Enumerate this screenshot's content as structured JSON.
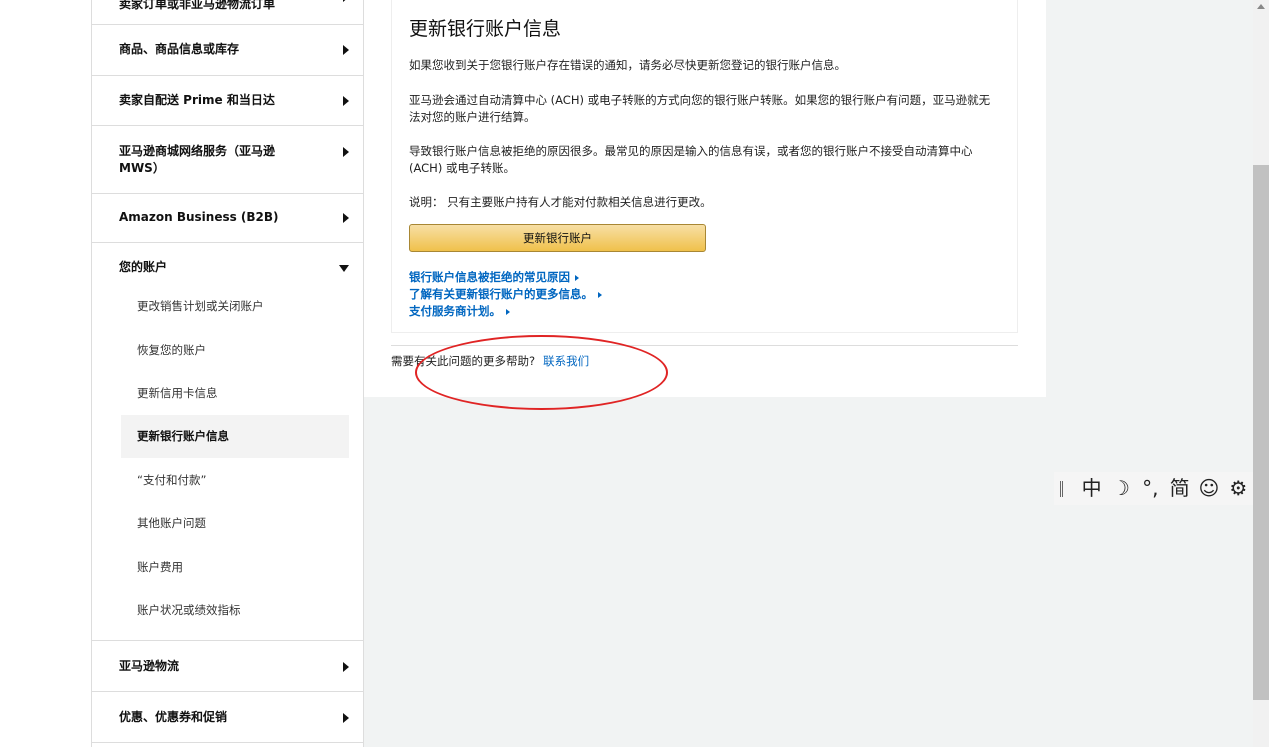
{
  "sidebar": {
    "top_item": "卖家订单或非亚马逊物流订单",
    "categories": [
      {
        "label": "商品、商品信息或库存"
      },
      {
        "label": "卖家自配送 Prime 和当日达"
      },
      {
        "label": "亚马逊商城网络服务（亚马逊 MWS）"
      },
      {
        "label": "Amazon Business (B2B)"
      },
      {
        "label": "您的账户"
      }
    ],
    "account_items": [
      {
        "label": "更改销售计划或关闭账户"
      },
      {
        "label": "恢复您的账户"
      },
      {
        "label": "更新信用卡信息"
      },
      {
        "label": "更新银行账户信息"
      },
      {
        "label": "“支付和付款”"
      },
      {
        "label": "其他账户问题"
      },
      {
        "label": "账户费用"
      },
      {
        "label": "账户状况或绩效指标"
      }
    ],
    "bottom_categories": [
      {
        "label": "亚马逊物流"
      },
      {
        "label": "优惠、优惠券和促销"
      }
    ]
  },
  "main": {
    "title": "更新银行账户信息",
    "paragraphs": [
      "如果您收到关于您银行账户存在错误的通知，请务必尽快更新您登记的银行账户信息。",
      "亚马逊会通过自动清算中心 (ACH) 或电子转账的方式向您的银行账户转账。如果您的银行账户有问题，亚马逊就无法对您的账户进行结算。",
      "导致银行账户信息被拒绝的原因很多。最常见的原因是输入的信息有误，或者您的银行账户不接受自动清算中心 (ACH) 或电子转账。",
      "说明： 只有主要账户持有人才能对付款相关信息进行更改。"
    ],
    "update_button": "更新银行账户",
    "links": [
      "银行账户信息被拒绝的常见原因",
      "了解有关更新银行账户的更多信息。",
      "支付服务商计划。"
    ],
    "help_text": "需要有关此问题的更多帮助?",
    "contact_link": "联系我们"
  },
  "ime_toolbar": {
    "mode": "中",
    "moon": "☽",
    "punct": "°,",
    "charset": "简",
    "emoji": "☺",
    "settings": "⚙"
  },
  "colors": {
    "link": "#0066c0",
    "button": "#f0c14b",
    "annotation": "#e02424"
  }
}
